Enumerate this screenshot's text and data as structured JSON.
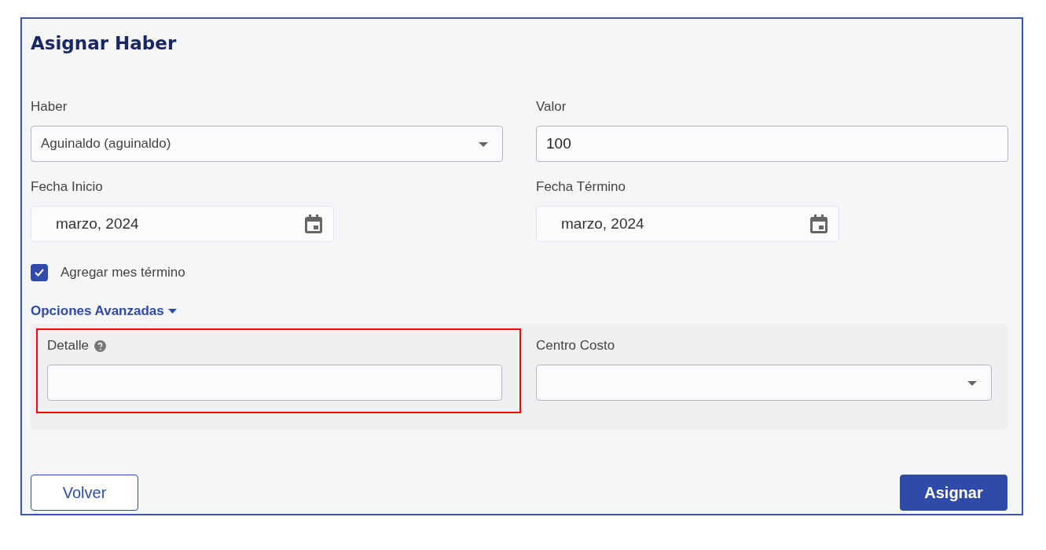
{
  "title": "Asignar Haber",
  "fields": [
    {
      "kind": "select",
      "label": "Haber",
      "value": "Aguinaldo (aguinaldo)"
    },
    {
      "kind": "text",
      "label": "Valor",
      "value": "100"
    }
  ],
  "dates": [
    {
      "label": "Fecha Inicio",
      "value": "marzo, 2024"
    },
    {
      "label": "Fecha Término",
      "value": "marzo, 2024"
    }
  ],
  "checkbox": {
    "label": "Agregar mes término",
    "checked": true
  },
  "advanced": {
    "label": "Opciones Avanzadas",
    "expanded": true,
    "fields": [
      {
        "kind": "text",
        "label": "Detalle",
        "help": true,
        "highlighted": true
      },
      {
        "kind": "select",
        "label": "Centro Costo",
        "help": false,
        "highlighted": false
      }
    ]
  },
  "buttons": [
    {
      "label": "Volver",
      "kind": "secondary"
    },
    {
      "label": "Asignar",
      "kind": "primary"
    }
  ]
}
